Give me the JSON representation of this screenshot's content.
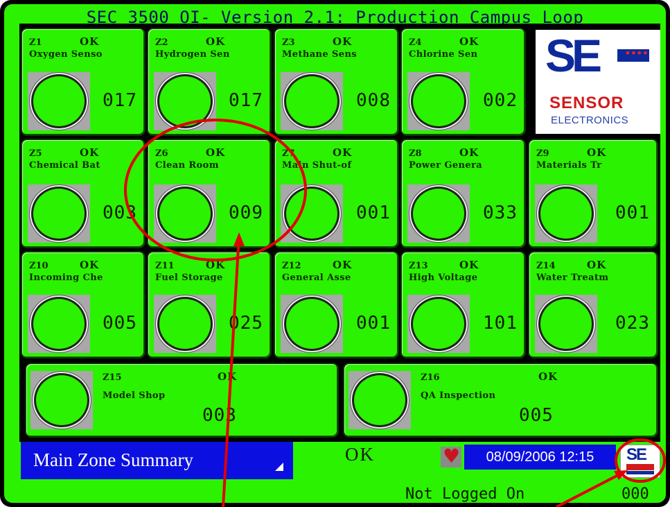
{
  "title": "SEC 3500 OI- Version 2.1: Production Campus Loop",
  "logo": {
    "main": "SE",
    "line1": "SENSOR",
    "line2": "ELECTRONICS"
  },
  "zones": [
    {
      "id": "Z1",
      "status": "OK",
      "name": "Oxygen Senso",
      "value": "017"
    },
    {
      "id": "Z2",
      "status": "OK",
      "name": "Hydrogen Sen",
      "value": "017"
    },
    {
      "id": "Z3",
      "status": "OK",
      "name": "Methane Sens",
      "value": "008"
    },
    {
      "id": "Z4",
      "status": "OK",
      "name": "Chlorine Sen",
      "value": "002"
    },
    {
      "id": "Z5",
      "status": "OK",
      "name": "Chemical Bat",
      "value": "003"
    },
    {
      "id": "Z6",
      "status": "OK",
      "name": "Clean Room",
      "value": "009"
    },
    {
      "id": "Z7",
      "status": "OK",
      "name": "Main Shut-of",
      "value": "001"
    },
    {
      "id": "Z8",
      "status": "OK",
      "name": "Power Genera",
      "value": "033"
    },
    {
      "id": "Z9",
      "status": "OK",
      "name": "Materials Tr",
      "value": "001"
    },
    {
      "id": "Z10",
      "status": "OK",
      "name": "Incoming Che",
      "value": "005"
    },
    {
      "id": "Z11",
      "status": "OK",
      "name": "Fuel Storage",
      "value": "025"
    },
    {
      "id": "Z12",
      "status": "OK",
      "name": "General Asse",
      "value": "001"
    },
    {
      "id": "Z13",
      "status": "OK",
      "name": "High Voltage",
      "value": "101"
    },
    {
      "id": "Z14",
      "status": "OK",
      "name": "Water Treatm",
      "value": "023"
    },
    {
      "id": "Z15",
      "status": "OK",
      "name": "Model Shop",
      "value": "003"
    },
    {
      "id": "Z16",
      "status": "OK",
      "name": "QA Inspection",
      "value": "005"
    }
  ],
  "footer": {
    "view_label": "Main Zone Summary",
    "system_status": "OK",
    "datetime": "08/09/2006 12:15",
    "mini_logo": "SE",
    "login_status": "Not Logged On",
    "counter": "000"
  },
  "colors": {
    "panel": "#2bf200",
    "footer_blue": "#0b10e0",
    "annotation": "#e00000"
  },
  "icons": [
    "alarm-icon",
    "gauge-icon",
    "dropdown-triangle-icon"
  ]
}
